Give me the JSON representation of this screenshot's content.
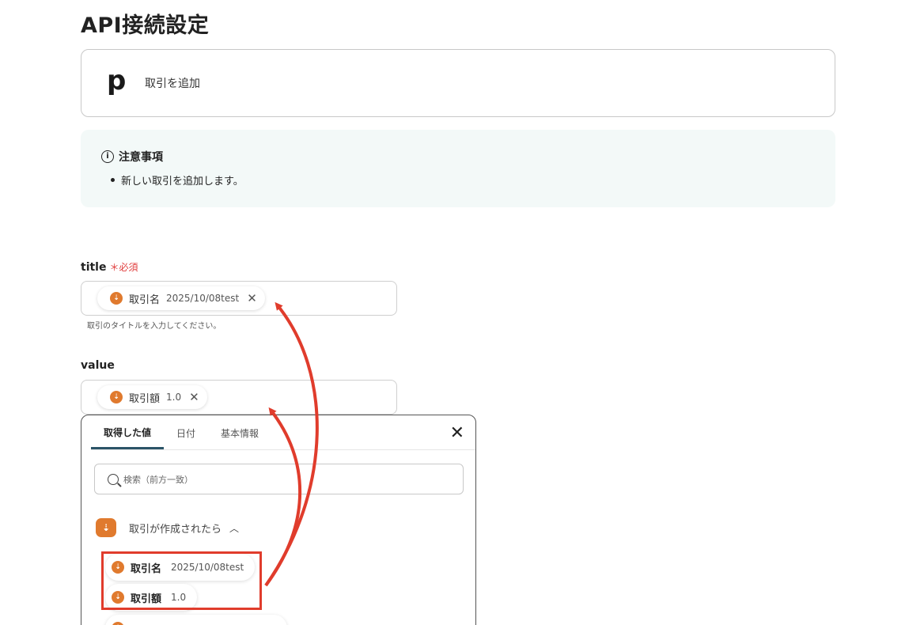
{
  "page": {
    "title": "API接続設定"
  },
  "app_card": {
    "logo": "p",
    "action": "取引を追加"
  },
  "notice": {
    "heading": "注意事項",
    "items": [
      "新しい取引を追加します。"
    ]
  },
  "fields": {
    "title": {
      "label": "title",
      "required": "＊必須",
      "chip": {
        "name": "取引名",
        "value": "2025/10/08test"
      },
      "help": "取引のタイトルを入力してください。"
    },
    "value": {
      "label": "value",
      "chip": {
        "name": "取引額",
        "value": "1.0"
      }
    }
  },
  "dropdown": {
    "tabs": [
      "取得した値",
      "日付",
      "基本情報"
    ],
    "search_placeholder": "検索（前方一致）",
    "section": {
      "title": "取引が作成されたら"
    },
    "items": [
      {
        "name": "取引名",
        "value": "2025/10/08test"
      },
      {
        "name": "取引額",
        "value": "1.0"
      }
    ]
  },
  "colors": {
    "accent": "#e07a2e",
    "annotation": "#e03c2c",
    "tab_active": "#2b5468",
    "required": "#e03c3c"
  },
  "icons": {
    "trigger": "trigger-icon",
    "close": "close-icon",
    "search": "search-icon",
    "info": "info-icon"
  }
}
